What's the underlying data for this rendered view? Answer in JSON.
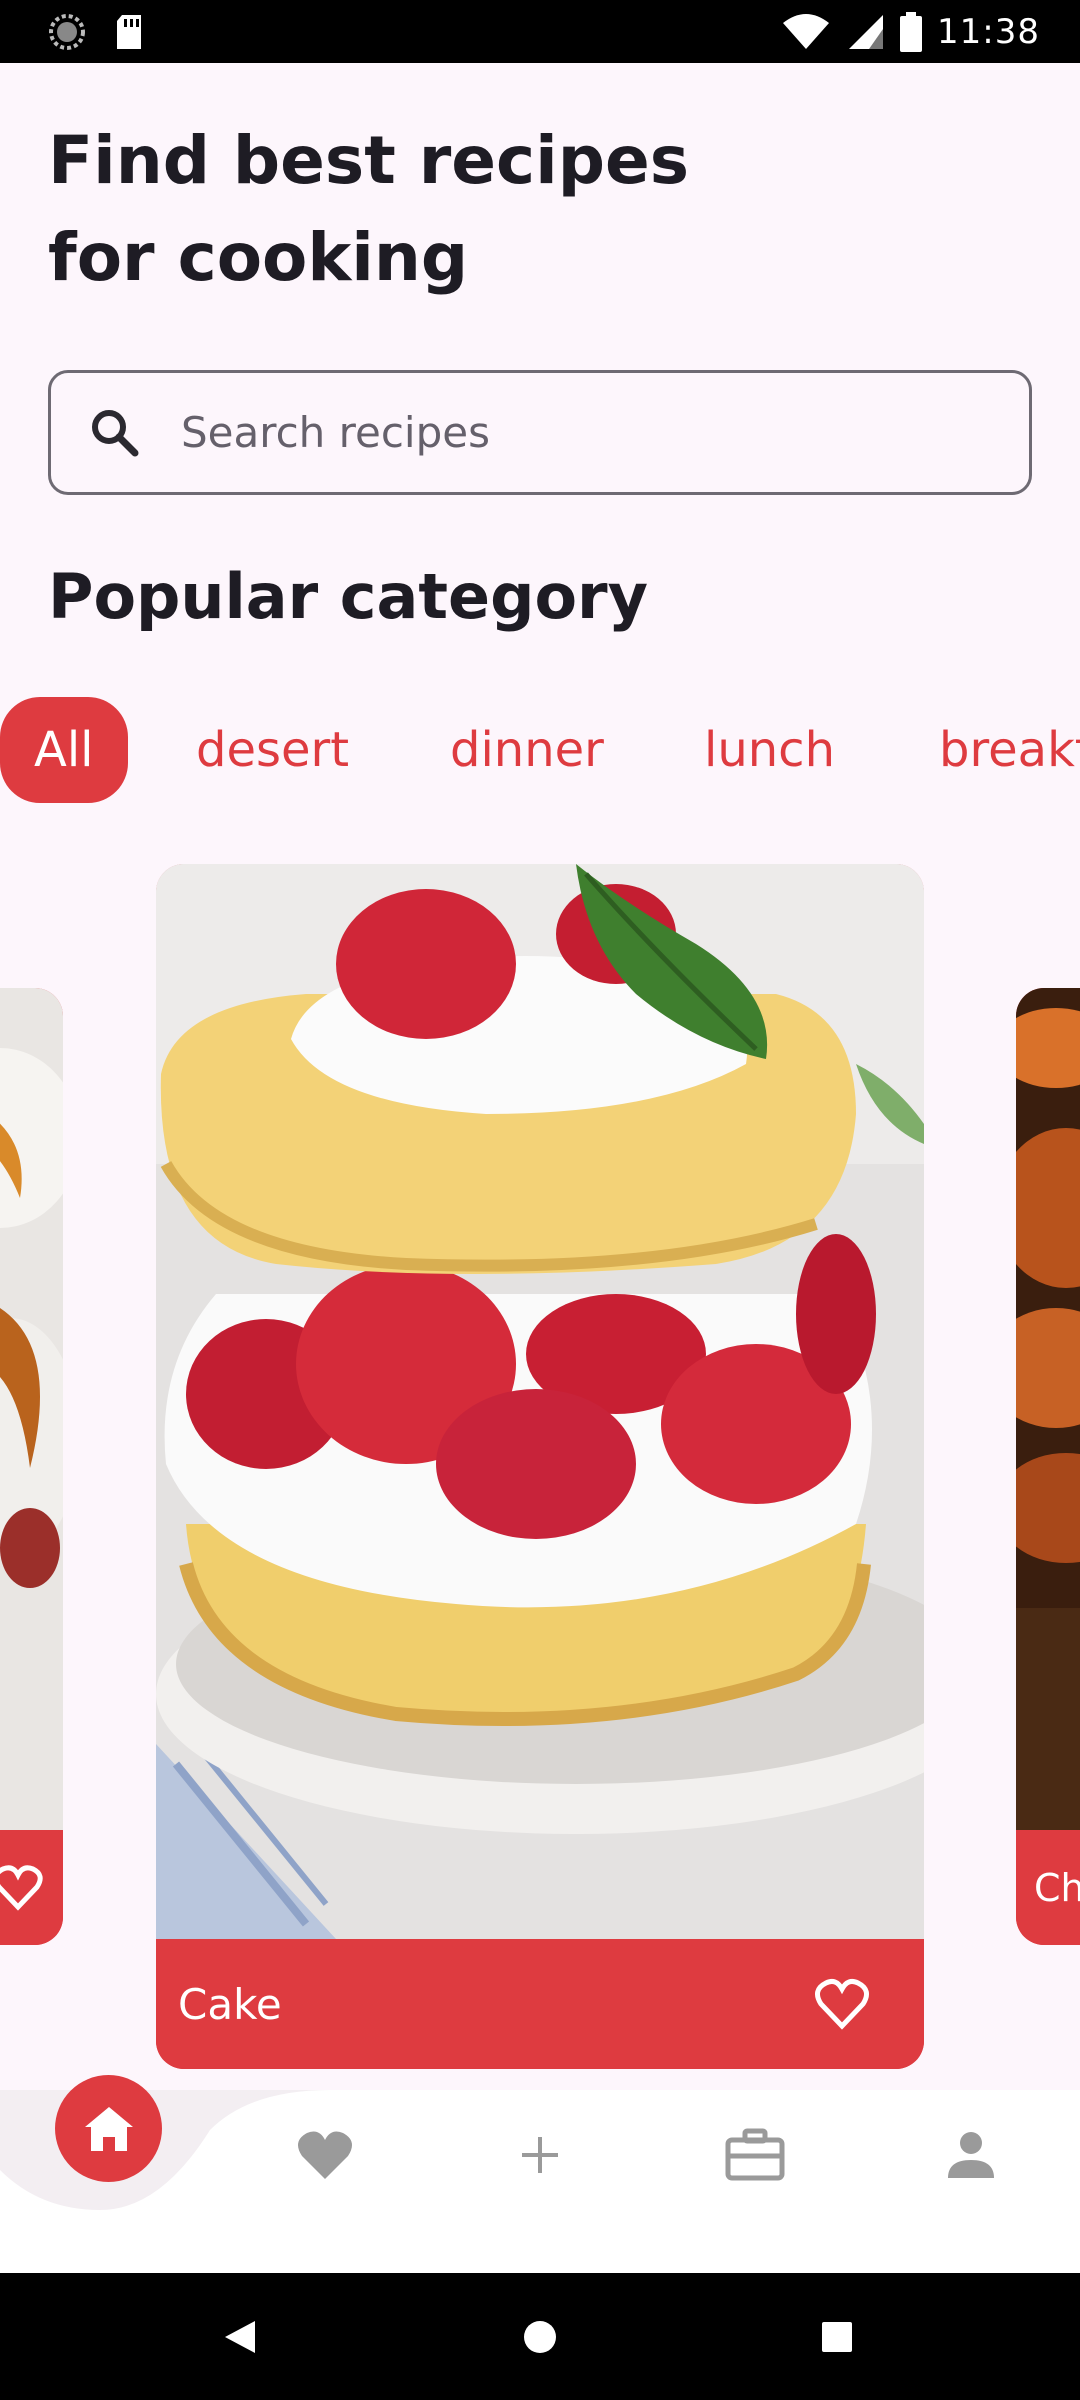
{
  "status_bar": {
    "time": "11:38"
  },
  "headline": {
    "line1": "Find best recipes",
    "line2": "for cooking"
  },
  "search": {
    "placeholder": "Search recipes"
  },
  "section_title": "Popular category",
  "categories": [
    {
      "label": "All",
      "active": true
    },
    {
      "label": "desert",
      "active": false
    },
    {
      "label": "dinner",
      "active": false
    },
    {
      "label": "lunch",
      "active": false
    },
    {
      "label": "breakfast",
      "active": false
    }
  ],
  "cards": {
    "left_partial": {
      "title": ""
    },
    "center": {
      "title": "Cake"
    },
    "right_partial": {
      "title": "Ch"
    }
  },
  "bottom_nav": {
    "items": [
      "home-icon",
      "heart-icon",
      "plus-icon",
      "briefcase-icon",
      "person-icon"
    ],
    "active": "home-icon"
  },
  "colors": {
    "accent": "#DE3B40",
    "background": "#FDF6FC",
    "text_primary": "#1E1C24"
  }
}
